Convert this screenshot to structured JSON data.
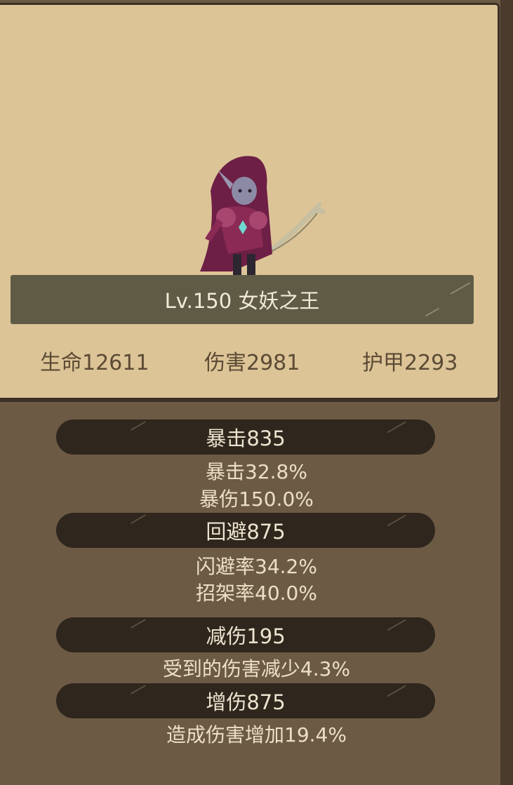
{
  "hero": {
    "banner": "Lv.150 女妖之王",
    "stats": [
      "生命12611",
      "伤害2981",
      "护甲2293"
    ]
  },
  "groups": [
    {
      "header": "暴击835",
      "lines": [
        "暴击32.8%",
        "暴伤150.0%"
      ]
    },
    {
      "header": "回避875",
      "lines": [
        "闪避率34.2%",
        "招架率40.0%"
      ]
    },
    {
      "header": "减伤195",
      "lines": [
        "受到的伤害减少4.3%"
      ]
    },
    {
      "header": "增伤875",
      "lines": [
        "造成伤害增加19.4%"
      ]
    }
  ],
  "colors": {
    "background": "#6d5a45",
    "panel": "#dcc497",
    "banner": "#5f5b45",
    "pill": "#2f261d",
    "character": "#8a2a55"
  }
}
